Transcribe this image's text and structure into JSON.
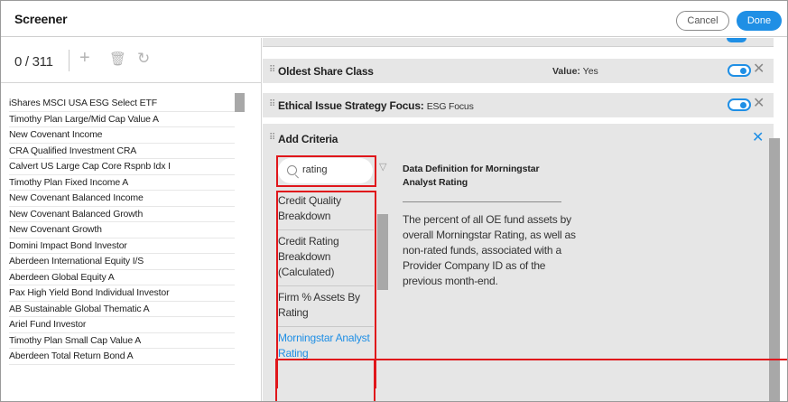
{
  "header": {
    "title": "Screener",
    "cancel_label": "Cancel",
    "done_label": "Done"
  },
  "left": {
    "count": "0 / 311",
    "tools": {
      "add": "+",
      "delete": "🗑",
      "refresh": "↻"
    },
    "funds": [
      "iShares MSCI USA ESG Select ETF",
      "Timothy Plan Large/Mid Cap Value A",
      "New Covenant Income",
      "CRA Qualified Investment CRA",
      "Calvert US Large Cap Core Rspnb Idx I",
      "Timothy Plan Fixed Income A",
      "New Covenant Balanced Income",
      "New Covenant Balanced Growth",
      "New Covenant Growth",
      "Domini Impact Bond Investor",
      "Aberdeen International Equity I/S",
      "Aberdeen Global Equity A",
      "Pax High Yield Bond Individual Investor",
      "AB Sustainable Global Thematic A",
      "Ariel Fund Investor",
      "Timothy Plan Small Cap Value A",
      "Aberdeen Total Return Bond A"
    ]
  },
  "criteria": {
    "oldest_share_class": {
      "label": "Oldest Share Class",
      "value_key": "Value:",
      "value": "Yes"
    },
    "ethical_issue": {
      "label": "Ethical Issue Strategy Focus:",
      "value": "ESG Focus"
    },
    "add": {
      "label": "Add Criteria",
      "search_value": "rating",
      "results": [
        "Credit Quality Breakdown",
        "Credit Rating Breakdown (Calculated)",
        "Firm % Assets By Rating",
        "Morningstar Analyst Rating"
      ],
      "definition_title": "Data Definition for Morningstar Analyst Rating",
      "definition_body": "The percent of all OE fund assets by overall Morningstar Rating, as well as non-rated funds, associated with a Provider Company ID as of the previous month-end."
    }
  },
  "icons": {
    "close": "✕",
    "funnel": "▽",
    "grip": "⠿"
  },
  "colors": {
    "accent": "#1f8fe5",
    "highlight": "#e0161b",
    "panel": "#e6e6e6"
  }
}
